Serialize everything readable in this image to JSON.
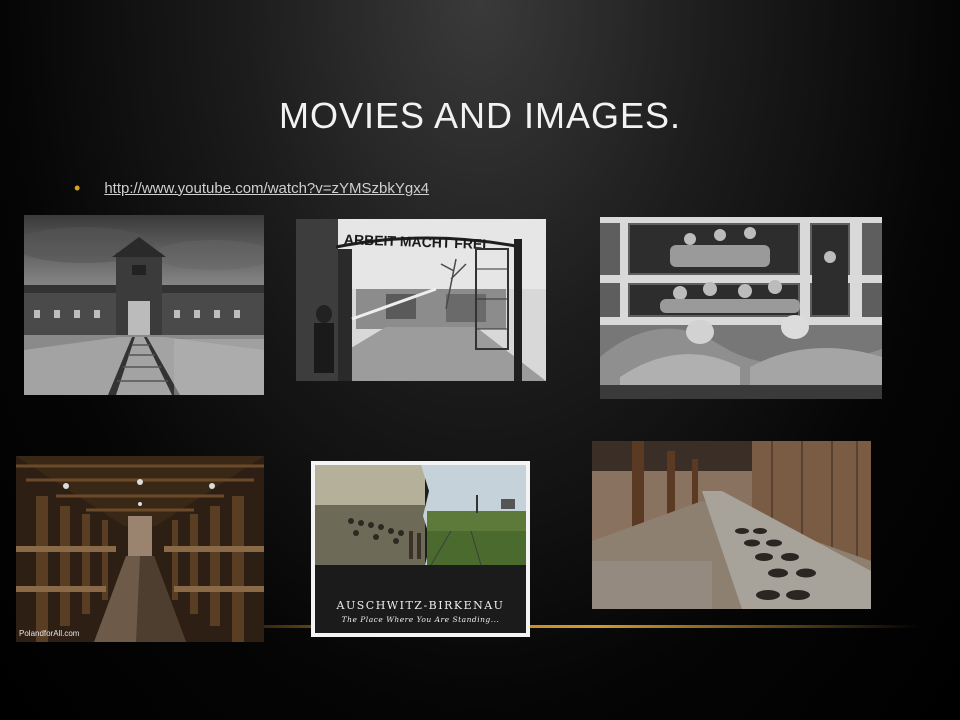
{
  "slide": {
    "title": "MOVIES AND IMAGES.",
    "bullets": [
      {
        "link_text": "http://www.youtube.com/watch?v=zYMSzbkYgx4"
      }
    ]
  },
  "images": {
    "gate_sign": {
      "text": "ARBEIT MACHT FREI"
    },
    "film_poster": {
      "title": "AUSCHWITZ-BIRKENAU",
      "subtitle": "The Place Where You Are Standing..."
    },
    "barracks_interior": {
      "watermark": "PolandforAll.com"
    }
  },
  "colors": {
    "bullet_accent": "#d6a020",
    "title_text": "#f2f2f2",
    "divider_gold": "#d49a2a"
  }
}
